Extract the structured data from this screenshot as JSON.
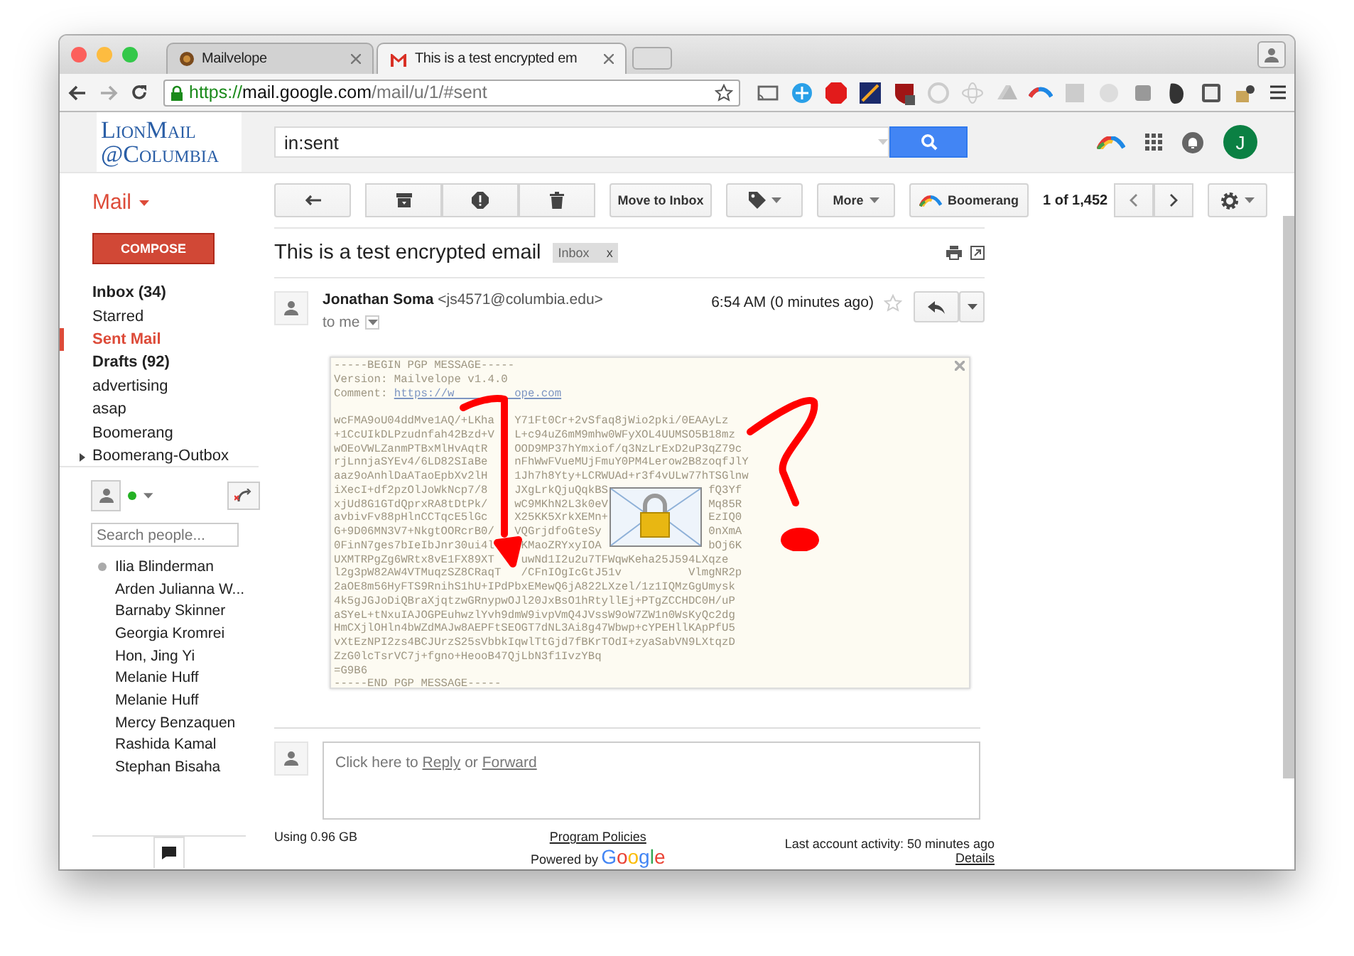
{
  "browser": {
    "tabs": [
      {
        "title": "Mailvelope",
        "kind": "mailvelope",
        "selected": false
      },
      {
        "title": "This is a test encrypted em",
        "kind": "gmail",
        "selected": true
      }
    ],
    "url": {
      "scheme": "https://",
      "host": "mail.google.com",
      "path": "/mail/u/1/#sent"
    }
  },
  "header": {
    "logo": [
      "LionMail",
      "@Columbia"
    ],
    "search": {
      "value": "in:sent"
    },
    "avatar": "J"
  },
  "sidebar": {
    "mail_label": "Mail",
    "compose": "COMPOSE",
    "folders": [
      {
        "label": "Inbox (34)",
        "bold": true,
        "selected": false,
        "expandable": false
      },
      {
        "label": "Starred",
        "bold": false,
        "selected": false,
        "expandable": false
      },
      {
        "label": "Sent Mail",
        "bold": false,
        "selected": true,
        "expandable": false
      },
      {
        "label": "Drafts (92)",
        "bold": true,
        "selected": false,
        "expandable": false
      },
      {
        "label": "advertising",
        "bold": false,
        "selected": false,
        "expandable": false
      },
      {
        "label": "asap",
        "bold": false,
        "selected": false,
        "expandable": false
      },
      {
        "label": "Boomerang",
        "bold": false,
        "selected": false,
        "expandable": false
      },
      {
        "label": "Boomerang-Outbox",
        "bold": false,
        "selected": false,
        "expandable": true
      }
    ],
    "people_search": {
      "placeholder": "Search people..."
    },
    "contacts": [
      {
        "name": "Ilia Blinderman",
        "online": true
      },
      {
        "name": "Arden Julianna W...",
        "online": false
      },
      {
        "name": "Barnaby Skinner",
        "online": false
      },
      {
        "name": "Georgia Kromrei",
        "online": false
      },
      {
        "name": "Hon, Jing Yi",
        "online": false
      },
      {
        "name": "Melanie Huff",
        "online": false
      },
      {
        "name": "Melanie Huff",
        "online": false
      },
      {
        "name": "Mercy Benzaquen",
        "online": false
      },
      {
        "name": "Rashida Kamal",
        "online": false
      },
      {
        "name": "Stephan Bisaha",
        "online": false
      }
    ]
  },
  "toolbar": {
    "move_to_inbox": "Move to Inbox",
    "more": "More",
    "boomerang": "Boomerang",
    "pager": "1 of 1,452"
  },
  "message": {
    "subject": "This is a test encrypted email",
    "label": "Inbox",
    "label_remove": "x",
    "sender_name": "Jonathan Soma",
    "sender_email": "<js4571@columbia.edu>",
    "time": "6:54 AM (0 minutes ago)",
    "starred": false,
    "recipient": "to me",
    "pgp": {
      "begin": "-----BEGIN PGP MESSAGE-----",
      "version": "Version: Mailvelope v1.4.0",
      "comment_label": "Comment:",
      "comment_link": "https://w         ope.com",
      "body": [
        "wcFMA9oU04ddMve1AQ/+LKha   Y71Ft0Cr+2vSfaq8jWio2pki/0EAAyLz",
        "+1CcUIkDLPzudnfah42Bzd+V   L+c94uZ6mM9mhw0WFyXOL4UUMSO5B18mz",
        "wOEoVWLZanmPTBxMlHvAqtR    OOD9MP37hYmxiof/q3NzLrExD2uP3qZ79c",
        "rjLnnjaSYEv4/6LD82SIaBe    nFhWwFVueMUjFmuY0PM4Lerow2B8zoqfJlY",
        "aaz9oAnhlDaATaoEpbXv2lH    1Jh7h8Yty+LCRWUAd+r3f4vULw77hTSGlnw",
        "iXecI+df2pzOlJoWkNcp7/8    JXgLrkQjuQqkBS               fQ3Yf",
        "xjUd8G1GTdQprxRA8tDtPk/    wC9MKhN2L3k0eV               Mq85R",
        "avbivFv88pHlnCCTqcE5lGc    X25KK5XrkXEMn+               EzIQ0",
        "G+9D06MN3V7+NkgtOORcrB0/   VQGrjdfoGteSy                0nXmA",
        "0FinN7ges7bIeIbJnr30ui4l    KMaoZRYxyIOA                bOj6K",
        "UXMTRPgZg6WRtx8vE1FX89XT    uwNd1I2u2u7TFWqwKeha25J594LXqze",
        "l2g3pW82AW4VTMuqzSZ8CRaqT   /CFnIOgIcGtJ51v          VlmgNR2p",
        "2aOE8m56HyFTS9RnihS1hU+IPdPbxEMewQ6jA822LXzel/1z1IQMzGgUmysk",
        "4k5gJGJoDiQBraXjqtzwGRnypwOJl20JxBsO1hRtyllEj+PTgZCCHDC0H/uP",
        "aSYeL+tNxuIAJOGPEuhwzlYvh9dmW9ivpVmQ4JVssW9oW7ZW1n0WsKyQc2dg",
        "HmCXjlOHln4bWZdMAJw8AEPFtSEOGT7dNL3Ai8g47Wbwp+cYPEHllKApPfU5",
        "vXtEzNPI2zs4BCJUrzS25sVbbkIqwlTtGjd7fBKrTOdI+zyaSabVN9LXtqzD",
        "ZzG0lcTsrVC7j+fgno+HeooB47QjLbN3f1IvzYBq",
        "=G9B6"
      ],
      "end": "-----END PGP MESSAGE-----"
    }
  },
  "reply_box": {
    "prefix": "Click here to",
    "reply": "Reply",
    "middle": "or",
    "forward": "Forward"
  },
  "footer": {
    "storage": "Using 0.96 GB",
    "policies": "Program Policies",
    "powered_by": "Powered by",
    "google": "Google",
    "activity": "Last account activity: 50 minutes ago",
    "details": "Details"
  }
}
